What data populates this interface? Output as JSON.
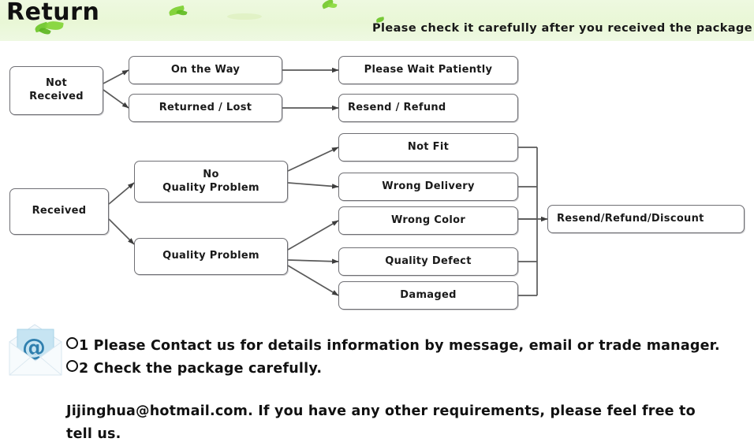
{
  "header": {
    "title": "Return",
    "subtitle": "Please check it carefully after you received the package",
    "background_color": "#e9f7d6",
    "leaf_color": "#6ec62a"
  },
  "flowchart": {
    "border_color": "#6f6f74",
    "arrow_color": "#4a4a4a",
    "nodes": [
      {
        "id": "not-received",
        "label": "Not\nReceived",
        "align": "center"
      },
      {
        "id": "on-the-way",
        "label": "On the Way",
        "align": "center"
      },
      {
        "id": "returned-lost",
        "label": "Returned / Lost",
        "align": "center"
      },
      {
        "id": "wait",
        "label": "Please Wait Patiently",
        "align": "center"
      },
      {
        "id": "resend-refund",
        "label": "Resend / Refund",
        "align": "left"
      },
      {
        "id": "received",
        "label": "Received",
        "align": "center"
      },
      {
        "id": "no-quality",
        "label": "No\nQuality Problem",
        "align": "center"
      },
      {
        "id": "quality",
        "label": "Quality Problem",
        "align": "center"
      },
      {
        "id": "not-fit",
        "label": "Not Fit",
        "align": "center"
      },
      {
        "id": "wrong-delivery",
        "label": "Wrong Delivery",
        "align": "center"
      },
      {
        "id": "wrong-color",
        "label": "Wrong Color",
        "align": "center"
      },
      {
        "id": "quality-defect",
        "label": "Quality Defect",
        "align": "center"
      },
      {
        "id": "damaged",
        "label": "Damaged",
        "align": "center"
      },
      {
        "id": "final-outcome",
        "label": "Resend/Refund/Discount",
        "align": "left"
      }
    ],
    "node_labels": {
      "not_received_line1": "Not",
      "not_received_line2": "Received",
      "on_the_way": "On the Way",
      "returned_lost": "Returned / Lost",
      "please_wait": "Please Wait Patiently",
      "resend_refund": "Resend / Refund",
      "received": "Received",
      "no_quality_line1": "No",
      "no_quality_line2": "Quality Problem",
      "quality_problem": "Quality Problem",
      "not_fit": "Not Fit",
      "wrong_delivery": "Wrong Delivery",
      "wrong_color": "Wrong Color",
      "quality_defect": "Quality Defect",
      "damaged": "Damaged",
      "final_outcome": "Resend/Refund/Discount"
    }
  },
  "notes": {
    "icon": "email-envelope-icon",
    "at_symbol": "@",
    "line1": "1 Please Contact us for details information by message, email or trade manager.",
    "line2": "2 Check the package carefully.",
    "line3": "Jijinghua@hotmail.com. If you have any other requirements, please feel free to",
    "line4": "tell us."
  }
}
